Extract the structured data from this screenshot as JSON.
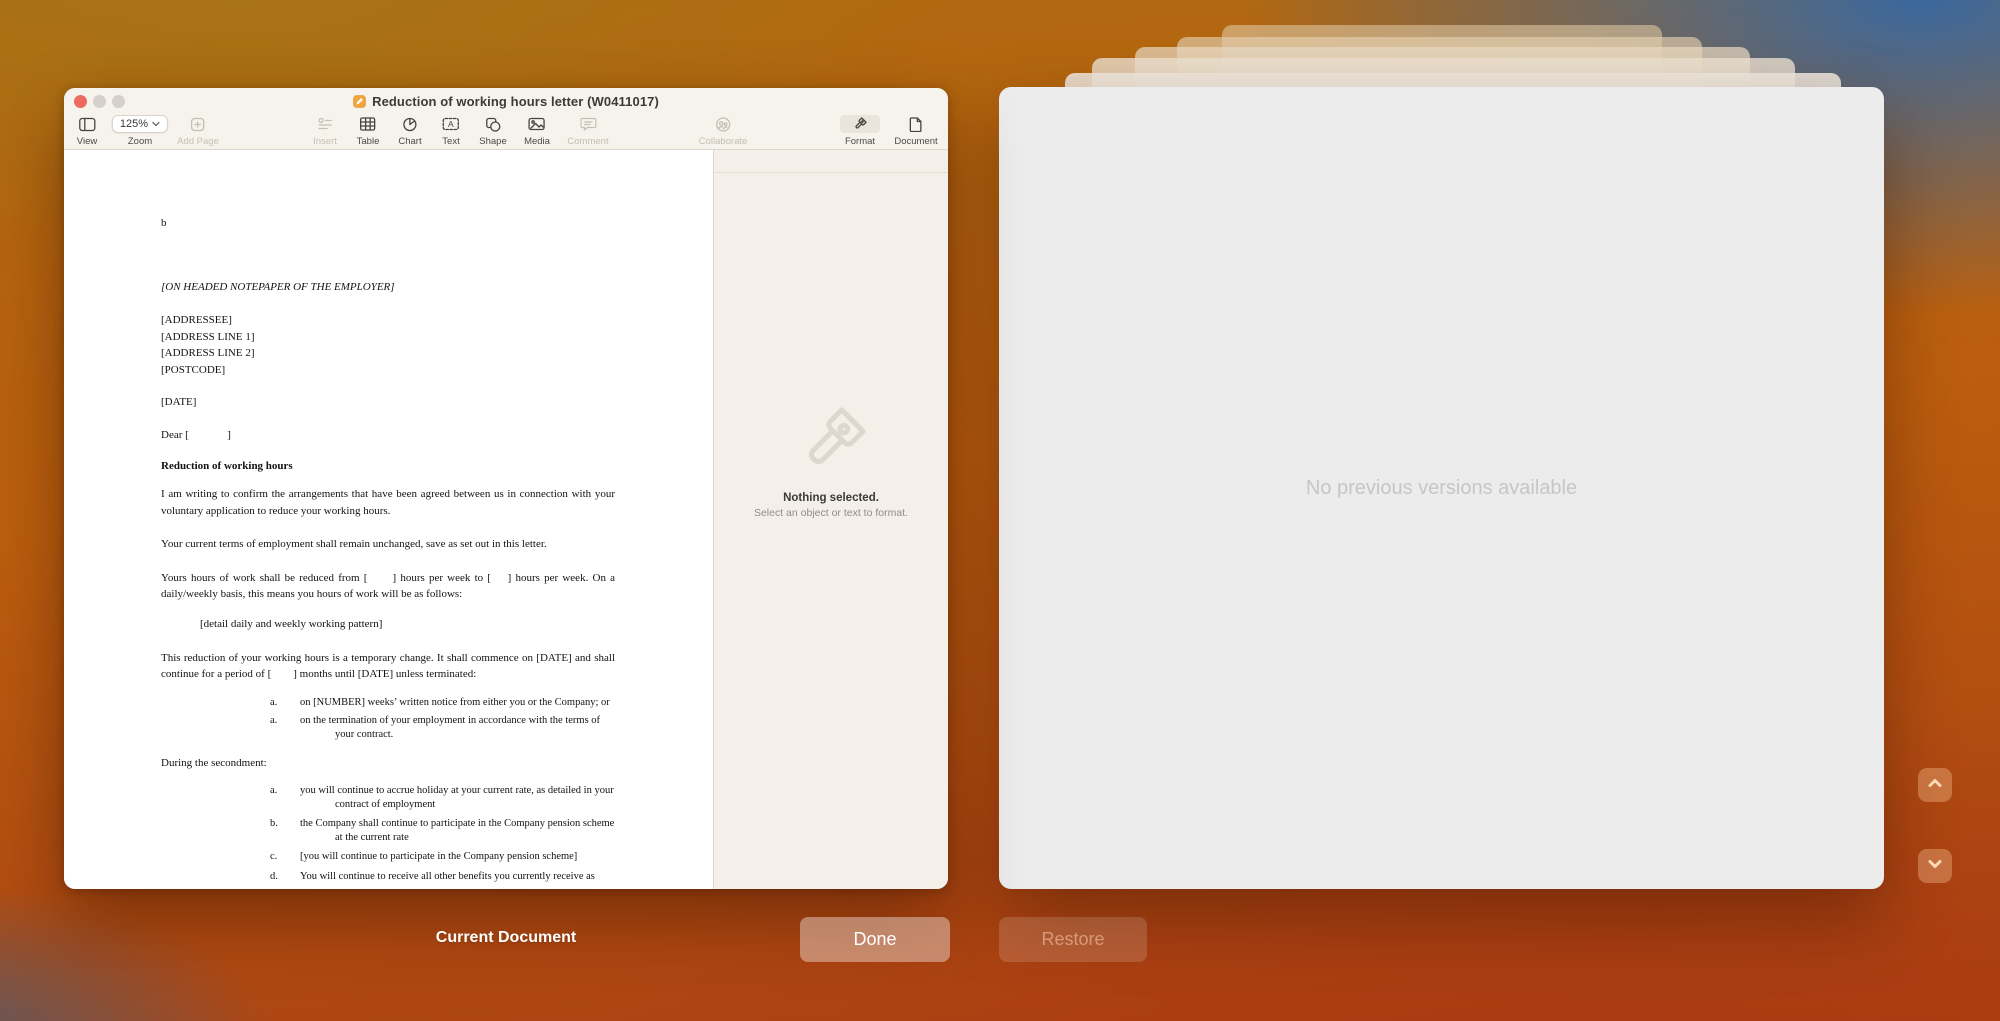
{
  "window": {
    "title": "Reduction of working hours letter (W0411017)"
  },
  "toolbar": {
    "view": "View",
    "zoom": "Zoom",
    "zoom_value": "125%",
    "add_page": "Add Page",
    "insert": "Insert",
    "table": "Table",
    "chart": "Chart",
    "text": "Text",
    "shape": "Shape",
    "media": "Media",
    "comment": "Comment",
    "collaborate": "Collaborate",
    "format": "Format",
    "document": "Document"
  },
  "document": {
    "stray": "b",
    "notepaper": "[ON HEADED NOTEPAPER OF THE EMPLOYER]",
    "addressee": "[ADDRESSEE]",
    "address1": "[ADDRESS LINE 1]",
    "address2": "[ADDRESS LINE 2]",
    "postcode": "[POSTCODE]",
    "date": "[DATE]",
    "salutation": "Dear [              ]",
    "heading": "Reduction of working hours",
    "para1": "I am writing to confirm the arrangements that have been agreed between us in connection with your voluntary application to reduce your working hours.",
    "para2": "Your current terms of employment shall remain unchanged, save as set out in this letter.",
    "para3": "Yours hours of work shall be reduced from [      ] hours per week to [    ] hours per week. On a daily/weekly basis, this means you hours of work will be as follows:",
    "pattern": "[detail daily and weekly working pattern]",
    "para4": "This reduction of your working hours is a temporary change.  It shall commence on [DATE] and shall continue for a period of [        ] months until [DATE] unless terminated:",
    "term_items": [
      {
        "marker": "a.",
        "text": "on [NUMBER] weeks’ written notice from either you or the Company; or"
      },
      {
        "marker": "a.",
        "text": "on the termination of your employment in accordance with the terms of your contract."
      }
    ],
    "secondment_label": "During the secondment:",
    "secondment_items": [
      {
        "marker": "a.",
        "text": "you will continue to accrue holiday at your current rate, as detailed in your contract of employment"
      },
      {
        "marker": "b.",
        "text": "the Company shall continue to participate in the Company pension scheme at the current rate"
      },
      {
        "marker": "c.",
        "text": "[you will continue to participate in the Company pension scheme]"
      },
      {
        "marker": "d.",
        "text": "You will continue to receive all other benefits you currently receive as"
      }
    ]
  },
  "inspector": {
    "title": "Nothing selected.",
    "subtitle": "Select an object or text to format."
  },
  "versions": {
    "empty_message": "No previous versions available"
  },
  "footer": {
    "current_label": "Current Document",
    "done": "Done",
    "restore": "Restore"
  },
  "colors": {
    "chrome_bg": "#f6f2ec",
    "page_white": "#ffffff",
    "version_panel": "#ececec",
    "close_red": "#ed6a5e",
    "accent_orange": "#c2690e",
    "background_blue": "#3468a6"
  }
}
